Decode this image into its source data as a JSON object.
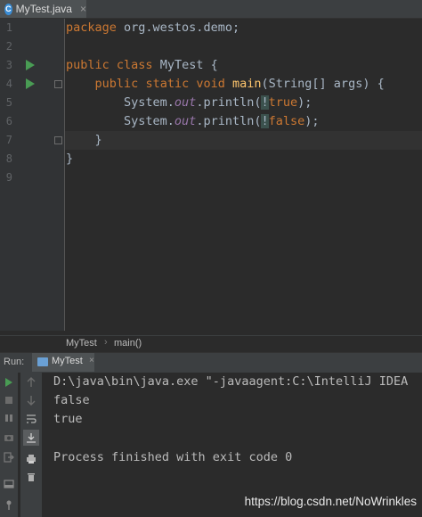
{
  "editor": {
    "tab": {
      "title": "MyTest.java",
      "icon": "java-class-icon",
      "close": "×"
    },
    "line_numbers": [
      "1",
      "2",
      "3",
      "4",
      "5",
      "6",
      "7",
      "8",
      "9"
    ],
    "code": {
      "l1_kw": "package",
      "l1_rest": " org.westos.demo;",
      "l3_kw1": "public",
      "l3_kw2": "class",
      "l3_name": "MyTest {",
      "l4_indent": "    ",
      "l4_kw1": "public",
      "l4_kw2": "static",
      "l4_kw3": "void",
      "l4_fn": "main",
      "l4_rest": "(String[] args) {",
      "l5_a": "        System.",
      "l5_out": "out",
      "l5_b": ".println(",
      "l5_not": "!",
      "l5_val": "true",
      "l5_c": ");",
      "l6_a": "        System.",
      "l6_out": "out",
      "l6_b": ".println(",
      "l6_not": "!",
      "l6_val": "false",
      "l6_c": ");",
      "l7": "    }",
      "l8": "}"
    }
  },
  "breadcrumb": {
    "items": [
      "MyTest",
      "main()"
    ],
    "separator": "›"
  },
  "run_panel": {
    "label": "Run:",
    "tab_title": "MyTest",
    "tab_close": "×",
    "console_lines": [
      "D:\\java\\bin\\java.exe \"-javaagent:C:\\IntelliJ IDEA",
      "false",
      "true",
      "",
      "Process finished with exit code 0"
    ],
    "watermark": "https://blog.csdn.net/NoWrinkles"
  },
  "colors": {
    "background": "#2b2b2b",
    "keyword": "#cc7832",
    "function": "#ffc66d",
    "field": "#9876aa",
    "text": "#a9b7c6",
    "run_green": "#499c54"
  }
}
